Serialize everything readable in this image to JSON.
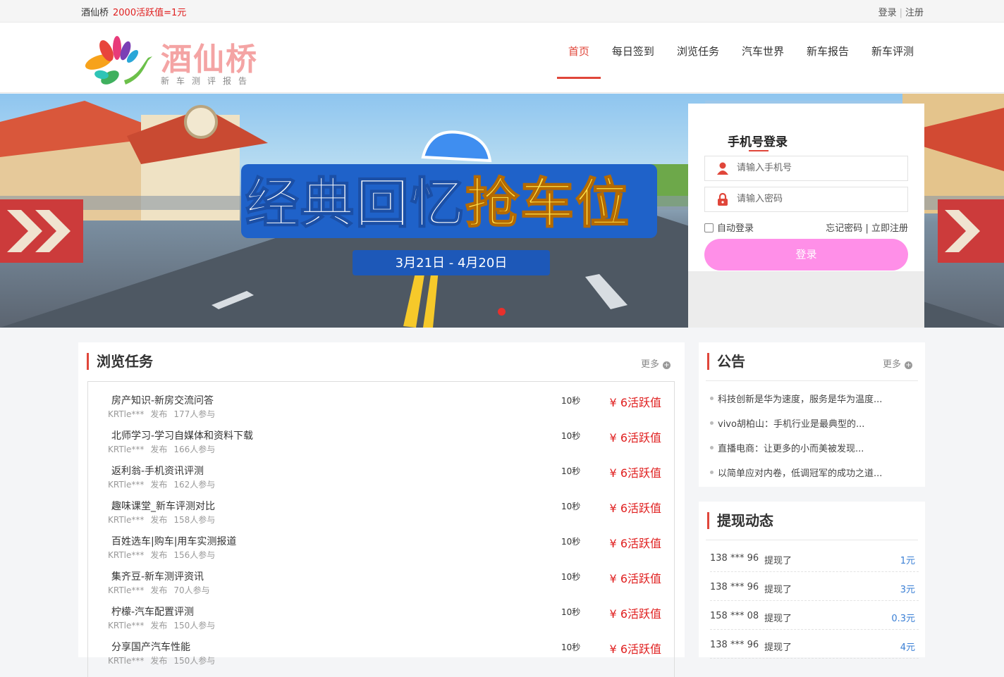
{
  "topbar": {
    "site_name": "酒仙桥",
    "promo": "2000活跃值=1元",
    "login": "登录",
    "separator": "|",
    "register": "注册"
  },
  "logo": {
    "name": "酒仙桥",
    "subtitle": "新车测评报告"
  },
  "nav": [
    {
      "label": "首页",
      "active": true
    },
    {
      "label": "每日签到",
      "active": false
    },
    {
      "label": "浏览任务",
      "active": false
    },
    {
      "label": "汽车世界",
      "active": false
    },
    {
      "label": "新车报告",
      "active": false
    },
    {
      "label": "新车评测",
      "active": false
    }
  ],
  "banner": {
    "headline_white": "经典回忆",
    "headline_yellow": "抢车位",
    "date_range": "3月21日 - 4月20日"
  },
  "login_panel": {
    "title": "手机号登录",
    "phone_placeholder": "请输入手机号",
    "password_placeholder": "请输入密码",
    "auto_login": "自动登录",
    "forgot": "忘记密码",
    "divider": "|",
    "register_now": "立即注册",
    "submit": "登录"
  },
  "tasks_section": {
    "title": "浏览任务",
    "more": "更多",
    "items": [
      {
        "title": "房产知识-新房交流问答",
        "user": "KRTle***",
        "publish": "发布",
        "participants": "177人参与",
        "duration": "10秒",
        "reward": "¥ 6活跃值"
      },
      {
        "title": "北师学习-学习自媒体和资料下载",
        "user": "KRTle***",
        "publish": "发布",
        "participants": "166人参与",
        "duration": "10秒",
        "reward": "¥ 6活跃值"
      },
      {
        "title": "返利翁-手机资讯评测",
        "user": "KRTle***",
        "publish": "发布",
        "participants": "162人参与",
        "duration": "10秒",
        "reward": "¥ 6活跃值"
      },
      {
        "title": "趣味课堂_新车评测对比",
        "user": "KRTle***",
        "publish": "发布",
        "participants": "158人参与",
        "duration": "10秒",
        "reward": "¥ 6活跃值"
      },
      {
        "title": "百姓选车|购车|用车实测报道",
        "user": "KRTle***",
        "publish": "发布",
        "participants": "156人参与",
        "duration": "10秒",
        "reward": "¥ 6活跃值"
      },
      {
        "title": "集齐豆-新车测评资讯",
        "user": "KRTle***",
        "publish": "发布",
        "participants": "70人参与",
        "duration": "10秒",
        "reward": "¥ 6活跃值"
      },
      {
        "title": "柠檬-汽车配置评测",
        "user": "KRTle***",
        "publish": "发布",
        "participants": "150人参与",
        "duration": "10秒",
        "reward": "¥ 6活跃值"
      },
      {
        "title": "分享国产汽车性能",
        "user": "KRTle***",
        "publish": "发布",
        "participants": "150人参与",
        "duration": "10秒",
        "reward": "¥ 6活跃值"
      }
    ]
  },
  "notice_section": {
    "title": "公告",
    "more": "更多",
    "items": [
      "科技创新是华为速度，服务是华为温度...",
      "vivo胡柏山：手机行业是最典型的...",
      "直播电商：让更多的小而美被发现...",
      "以简单应对内卷，低调冠军的成功之道..."
    ]
  },
  "withdraw_section": {
    "title": "提现动态",
    "items": [
      {
        "phone": "138 *** 96",
        "action": "提现了",
        "amount": "1元"
      },
      {
        "phone": "138 *** 96",
        "action": "提现了",
        "amount": "3元"
      },
      {
        "phone": "158 *** 08",
        "action": "提现了",
        "amount": "0.3元"
      },
      {
        "phone": "138 *** 96",
        "action": "提现了",
        "amount": "4元"
      }
    ]
  },
  "colors": {
    "accent": "#e0463a",
    "price": "#e02020",
    "login_button": "#ff8fe8",
    "amount": "#3a7fd5"
  }
}
